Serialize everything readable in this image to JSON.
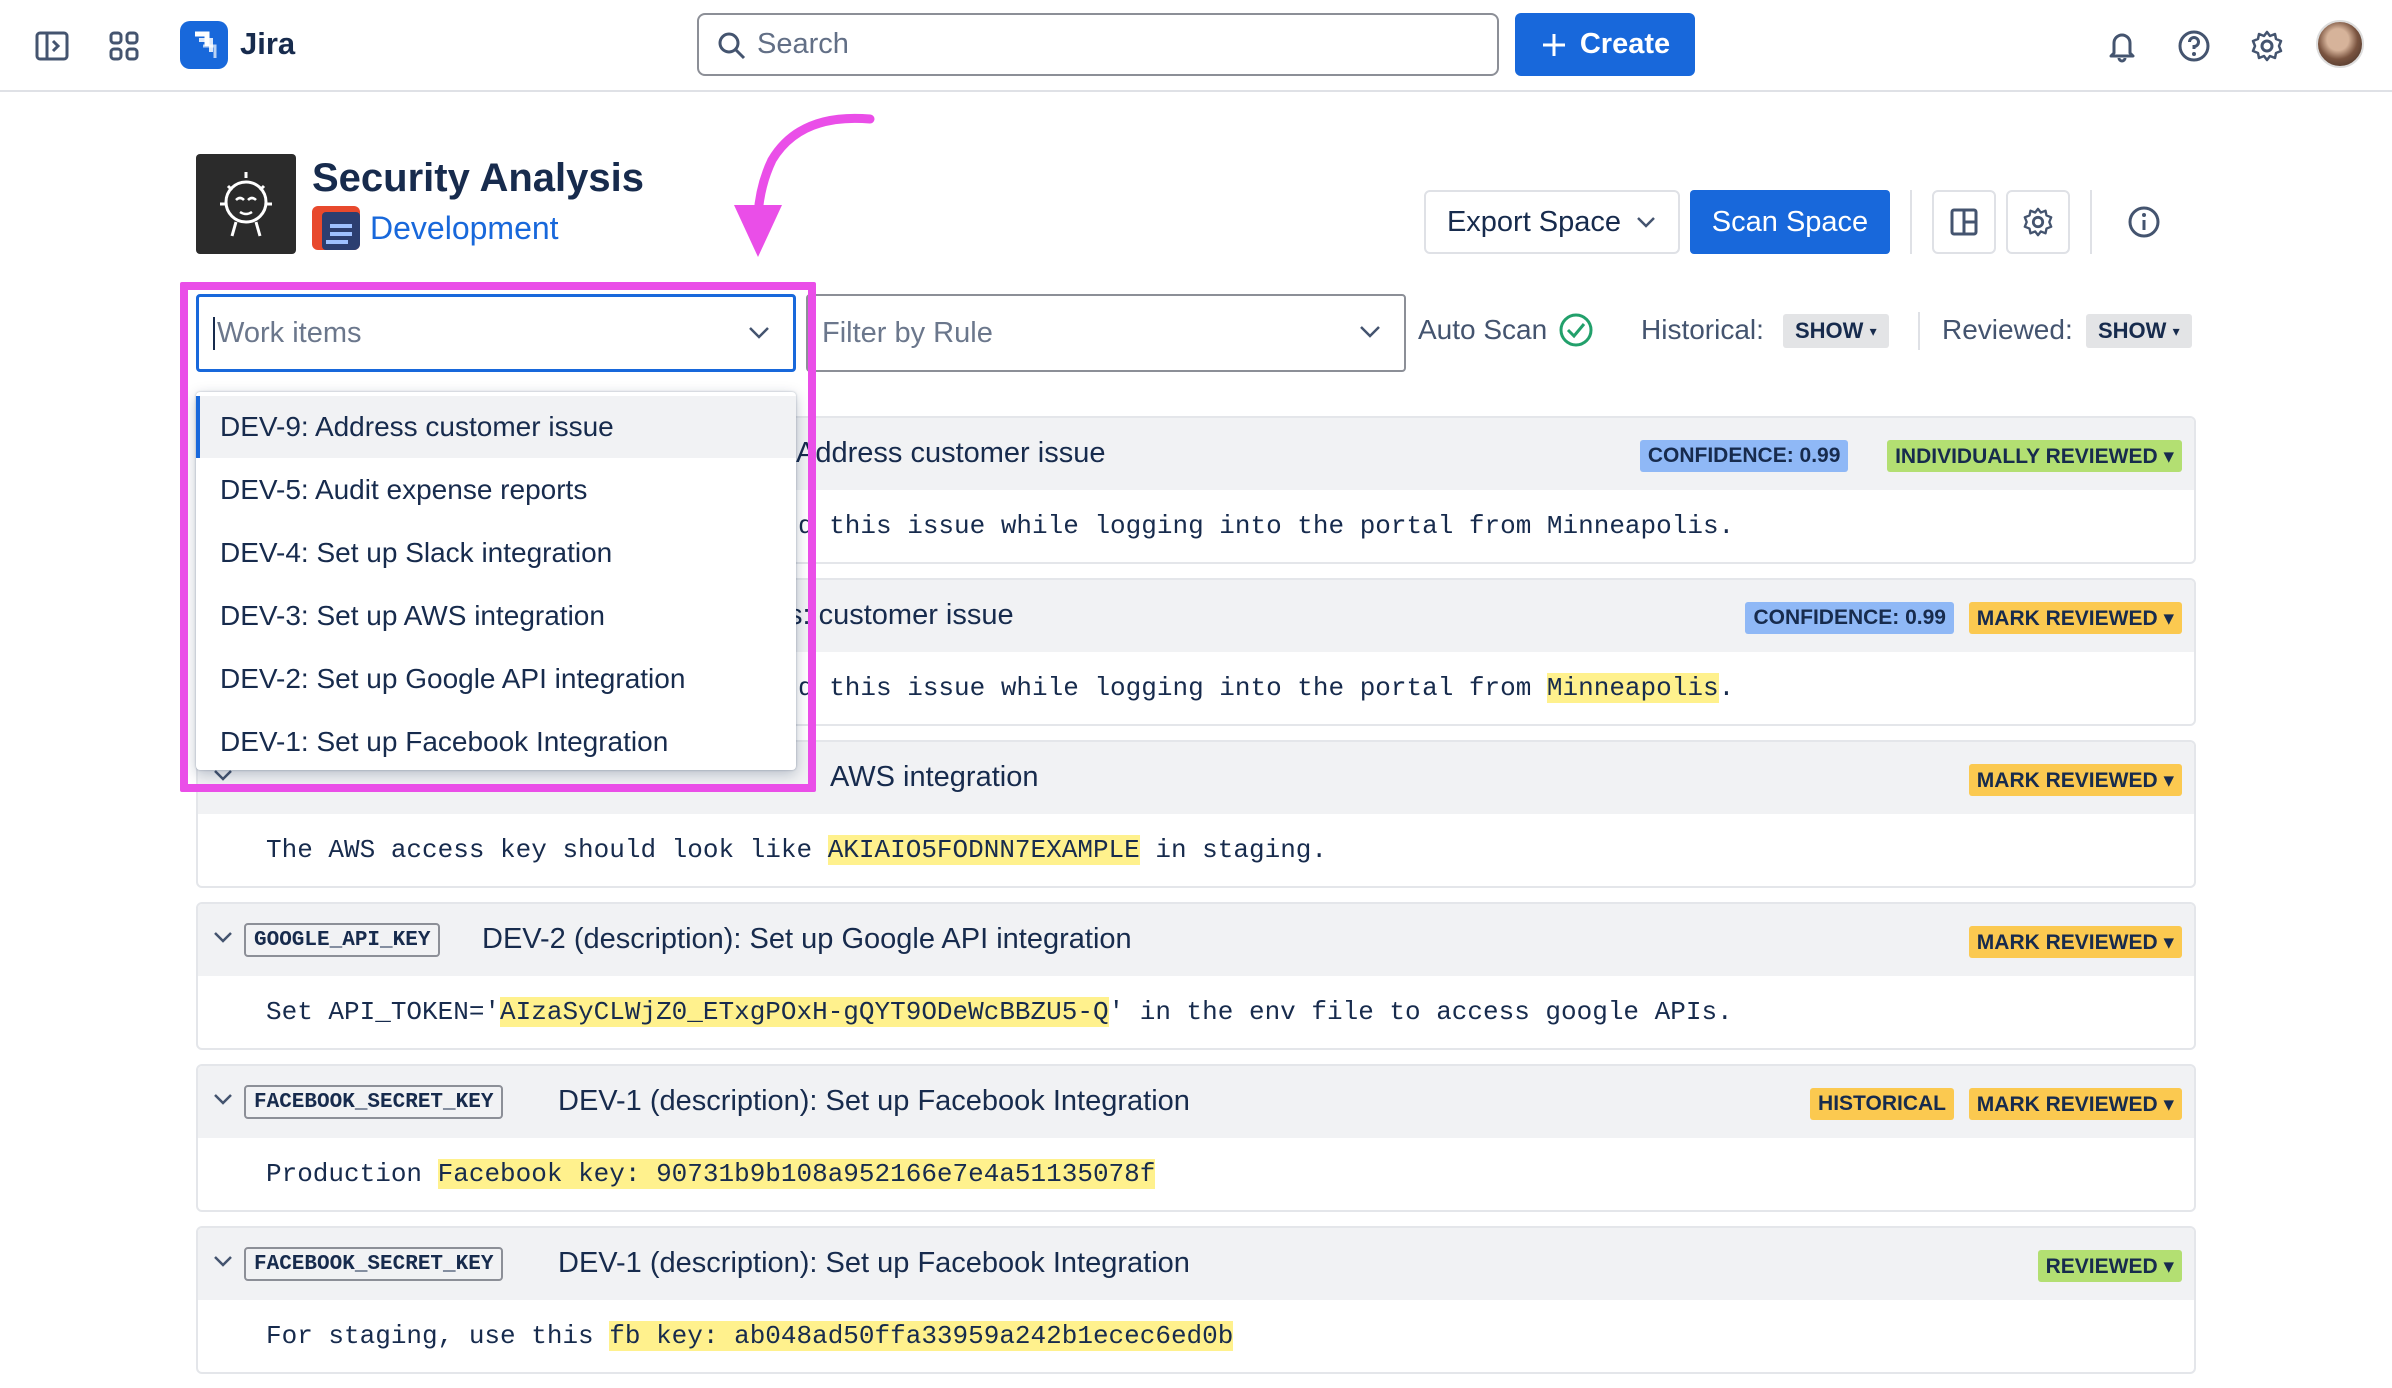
{
  "topbar": {
    "app_name": "Jira",
    "search_placeholder": "Search",
    "create_label": "Create"
  },
  "header": {
    "title": "Security Analysis",
    "space": "Development",
    "export_label": "Export Space",
    "scan_label": "Scan Space"
  },
  "filters": {
    "work_items_placeholder": "Work items",
    "rule_placeholder": "Filter by Rule",
    "auto_scan_label": "Auto Scan",
    "historical_label": "Historical:",
    "historical_value": "SHOW",
    "reviewed_label": "Reviewed:",
    "reviewed_value": "SHOW"
  },
  "dropdown": {
    "items": [
      "DEV-9: Address customer issue",
      "DEV-5: Audit expense reports",
      "DEV-4: Set up Slack integration",
      "DEV-3: Set up AWS integration",
      "DEV-2: Set up Google API integration",
      "DEV-1: Set up Facebook Integration"
    ],
    "active_index": 0
  },
  "findings": [
    {
      "tag": "",
      "title": "Address customer issue",
      "badges": [
        {
          "text": "CONFIDENCE: 0.99",
          "color": "#8fb8f6"
        },
        {
          "text": "INDIVIDUALLY REVIEWED ▾",
          "color": "#b3df72"
        }
      ],
      "body_before": "d this issue while logging into the portal from Minneapolis.",
      "body_highlight": "",
      "body_after": ""
    },
    {
      "tag": "",
      "title": "s: customer issue",
      "badges": [
        {
          "text": "CONFIDENCE: 0.99",
          "color": "#8fb8f6"
        },
        {
          "text": "MARK REVIEWED ▾",
          "color": "#fbc950"
        }
      ],
      "body_before": "d this issue while logging into the portal from ",
      "body_highlight": "Minneapolis",
      "body_after": "."
    },
    {
      "tag": "",
      "title": "AWS integration",
      "badges": [
        {
          "text": "MARK REVIEWED ▾",
          "color": "#fbc950"
        }
      ],
      "body_before": "The AWS access key should look like ",
      "body_highlight": "AKIAIO5FODNN7EXAMPLE",
      "body_after": " in staging."
    },
    {
      "tag": "GOOGLE_API_KEY",
      "title": "DEV-2 (description): Set up Google API integration",
      "badges": [
        {
          "text": "MARK REVIEWED ▾",
          "color": "#fbc950"
        }
      ],
      "body_before": "Set API_TOKEN='",
      "body_highlight": "AIzaSyCLWjZ0_ETxgPOxH-gQYT9ODeWcBBZU5-Q",
      "body_after": "' in the env file to access google APIs."
    },
    {
      "tag": "FACEBOOK_SECRET_KEY",
      "title": "DEV-1 (description): Set up Facebook Integration",
      "badges": [
        {
          "text": "HISTORICAL",
          "color": "#fbc950"
        },
        {
          "text": "MARK REVIEWED ▾",
          "color": "#fbc950"
        }
      ],
      "body_before": "Production ",
      "body_highlight": "Facebook key: 90731b9b108a952166e7e4a51135078f",
      "body_after": ""
    },
    {
      "tag": "FACEBOOK_SECRET_KEY",
      "title": "DEV-1 (description): Set up Facebook Integration",
      "badges": [
        {
          "text": "REVIEWED ▾",
          "color": "#b3df72"
        }
      ],
      "body_before": "For staging, use this ",
      "body_highlight": "fb key: ab048ad50ffa33959a242b1ecec6ed0b",
      "body_after": ""
    }
  ],
  "colors": {
    "accent": "#1868db",
    "annotation": "#ea4ee8",
    "success": "#22a06b"
  }
}
